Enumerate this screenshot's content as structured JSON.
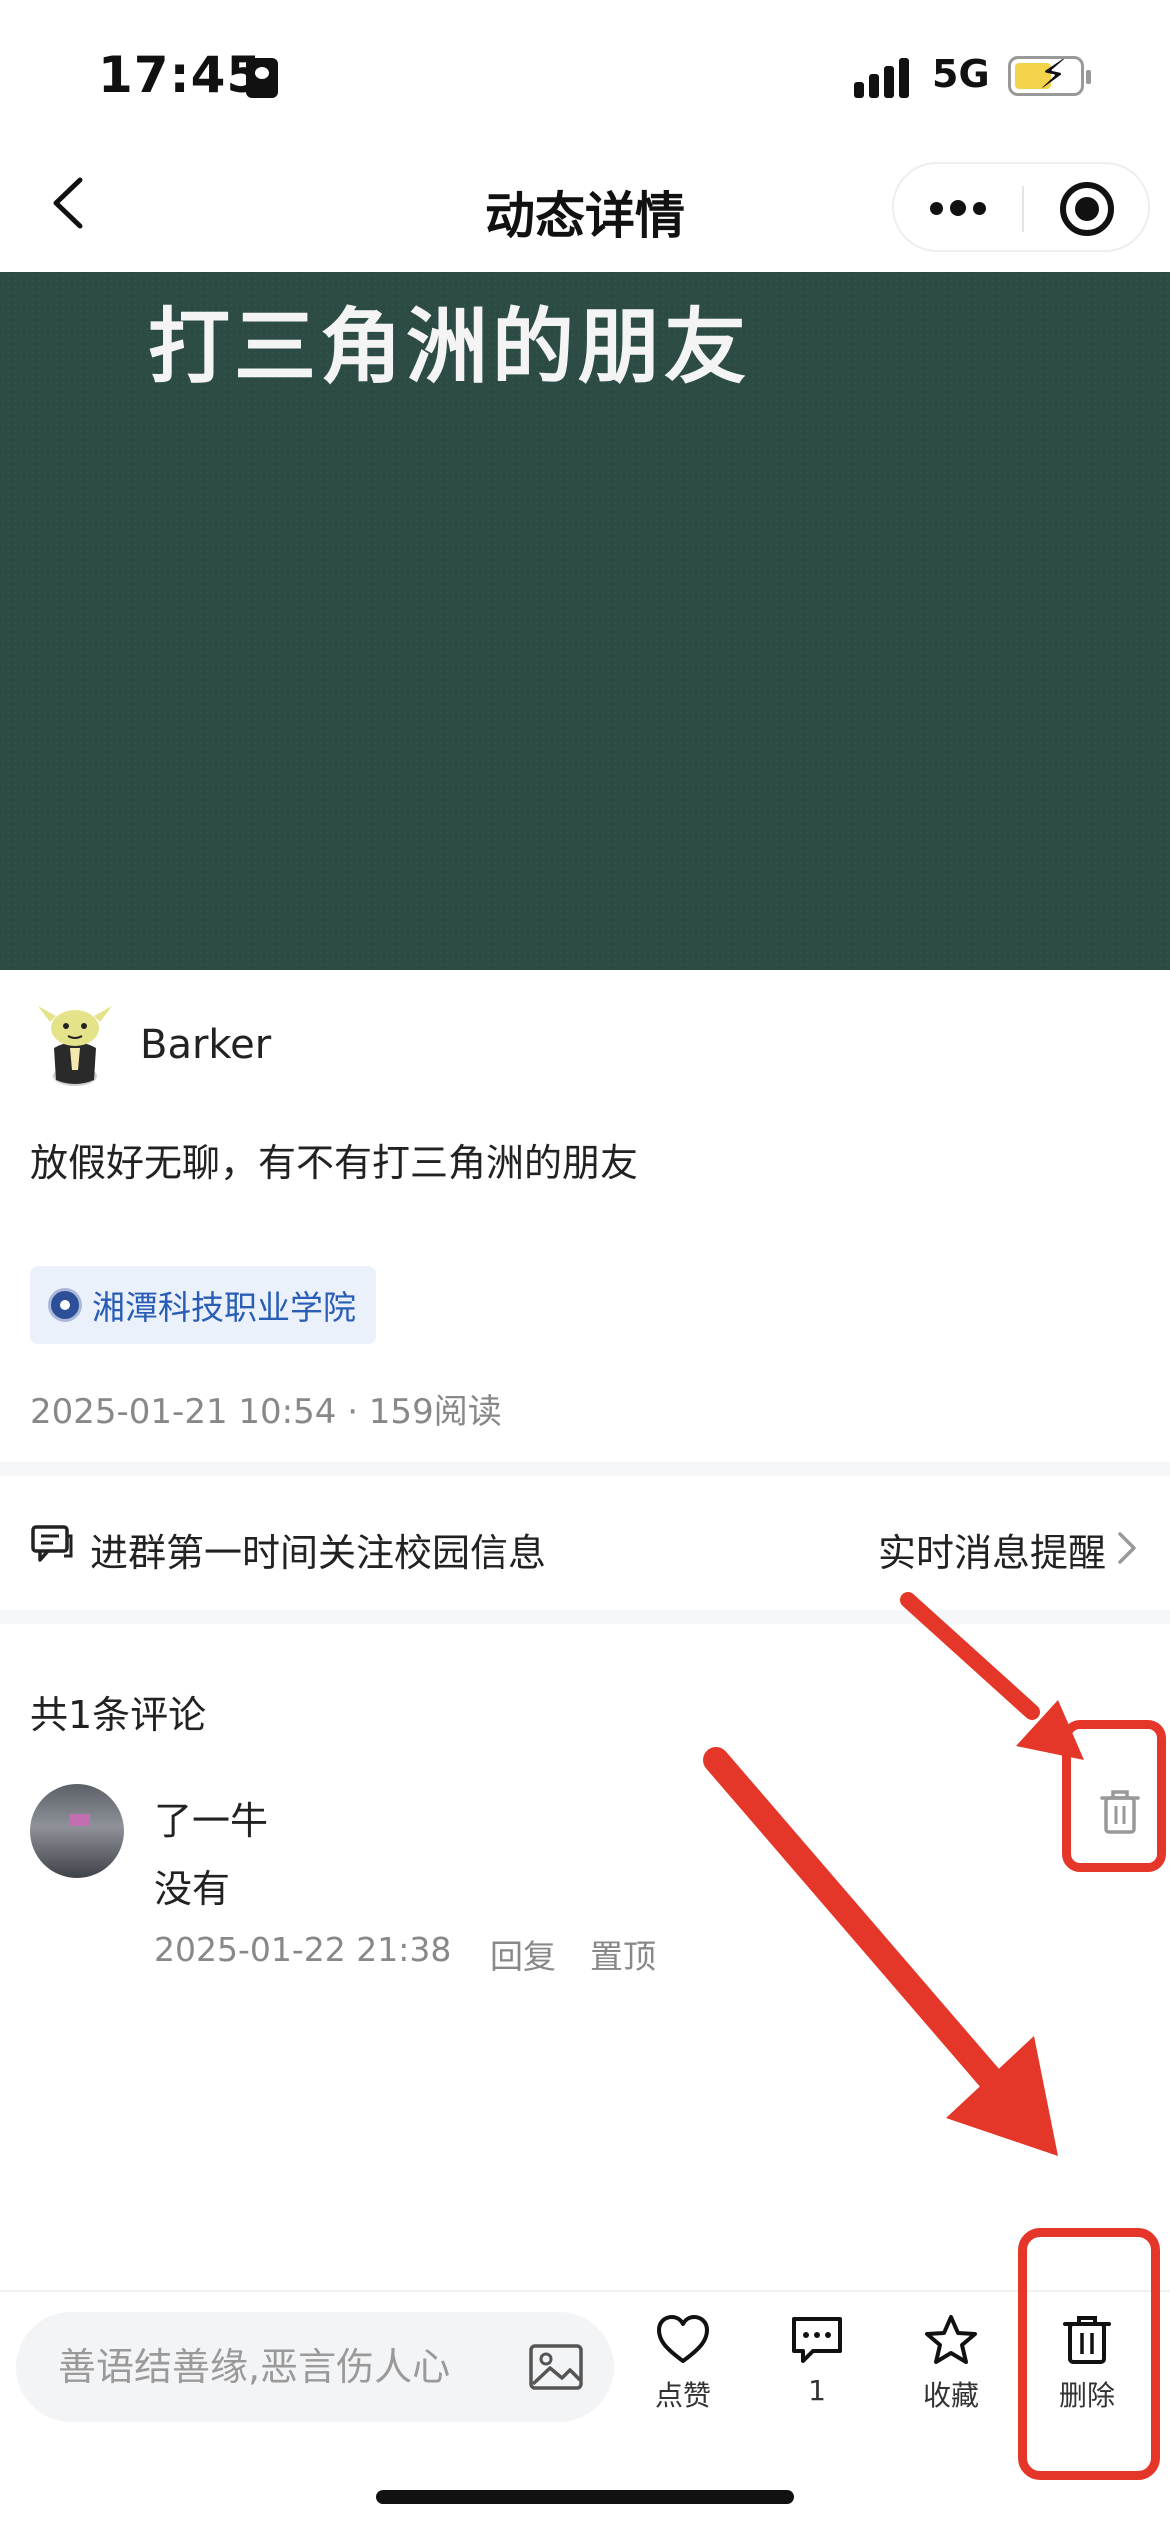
{
  "status_bar": {
    "time": "17:45",
    "network": "5G"
  },
  "nav": {
    "title": "动态详情"
  },
  "hero": {
    "overlay_text": "打三角洲的朋友",
    "background": "#2c4b45"
  },
  "post": {
    "author": "Barker",
    "content": "放假好无聊，有不有打三角洲的朋友",
    "school": "湘潭科技职业学院",
    "meta": "2025-01-21 10:54 · 159阅读"
  },
  "group_banner": {
    "text": "进群第一时间关注校园信息",
    "action": "实时消息提醒"
  },
  "comments": {
    "count_label": "共1条评论",
    "items": [
      {
        "user": "了一牛",
        "text": "没有",
        "time": "2025-01-22 21:38",
        "reply_label": "回复",
        "pin_label": "置顶"
      }
    ]
  },
  "bottom_bar": {
    "input_placeholder": "善语结善缘,恶言伤人心",
    "like_label": "点赞",
    "comment_count": "1",
    "favorite_label": "收藏",
    "delete_label": "删除"
  },
  "colors": {
    "accent_link": "#2a5db5",
    "annotation": "#e5362a",
    "muted": "#888888"
  }
}
